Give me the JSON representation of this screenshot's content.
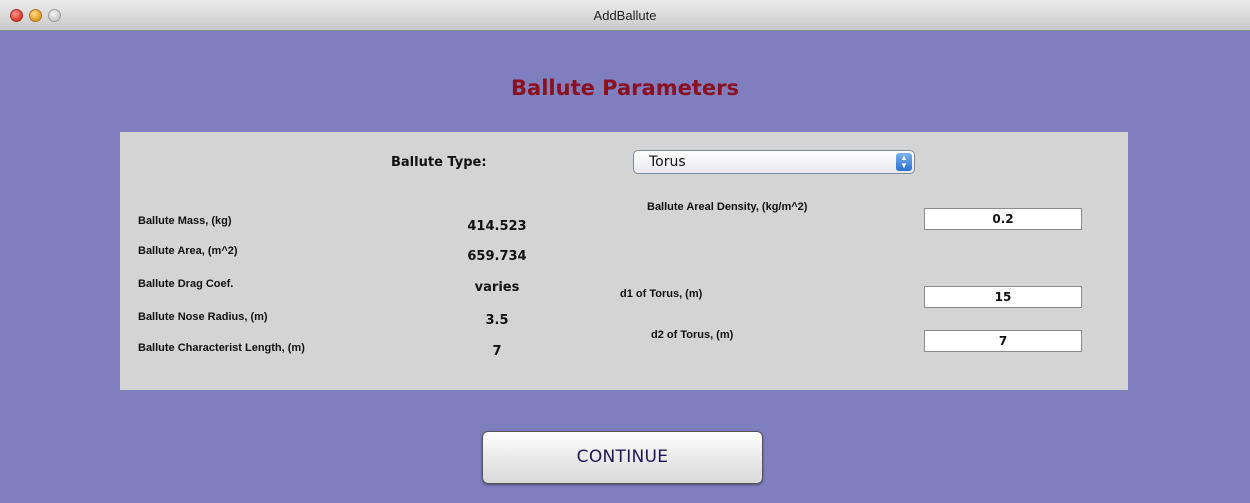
{
  "window": {
    "title": "AddBallute"
  },
  "heading": "Ballute Parameters",
  "ballute_type": {
    "label": "Ballute Type:",
    "selected": "Torus"
  },
  "outputs": [
    {
      "label": "Ballute Mass, (kg)",
      "value": "414.523"
    },
    {
      "label": "Ballute Area, (m^2)",
      "value": "659.734"
    },
    {
      "label": "Ballute Drag Coef.",
      "value": "varies"
    },
    {
      "label": "Ballute Nose Radius, (m)",
      "value": "3.5"
    },
    {
      "label": "Ballute Characterist Length, (m)",
      "value": "7"
    }
  ],
  "inputs": {
    "areal_density": {
      "label": "Ballute Areal Density, (kg/m^2)",
      "value": "0.2"
    },
    "d1": {
      "label": "d1 of Torus, (m)",
      "value": "15"
    },
    "d2": {
      "label": "d2 of Torus, (m)",
      "value": "7"
    }
  },
  "continue_label": "CONTINUE",
  "colors": {
    "background": "#7f7fc0",
    "panel": "#d4d4d4",
    "heading": "#8b1020",
    "button_text": "#1e1656"
  }
}
